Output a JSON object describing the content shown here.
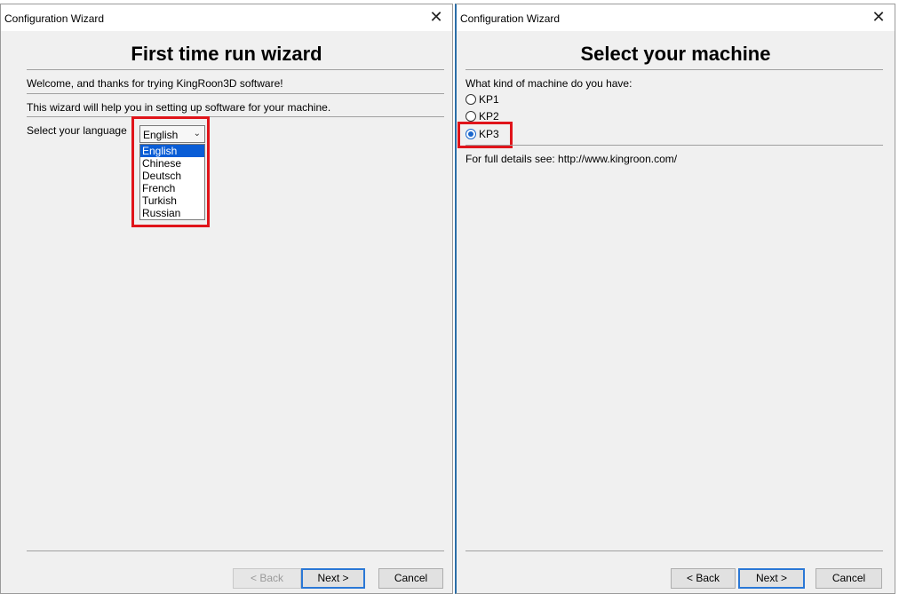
{
  "left": {
    "window_title": "Configuration Wizard",
    "close_glyph": "✕",
    "heading": "First time run wizard",
    "welcome_text": "Welcome, and thanks for trying KingRoon3D software!",
    "help_text": "This wizard will help you in setting up software for your machine.",
    "language_label": "Select your language",
    "language_selected": "English",
    "language_options": [
      "English",
      "Chinese",
      "Deutsch",
      "French",
      "Turkish",
      "Russian"
    ],
    "buttons": {
      "back": "< Back",
      "next": "Next >",
      "cancel": "Cancel"
    }
  },
  "right": {
    "window_title": "Configuration Wizard",
    "close_glyph": "✕",
    "heading": "Select your machine",
    "question": "What kind of machine do you have:",
    "machines": [
      "KP1",
      "KP2",
      "KP3"
    ],
    "selected_machine": "KP3",
    "details_text": "For full details see: http://www.kingroon.com/",
    "buttons": {
      "back": "< Back",
      "next": "Next >",
      "cancel": "Cancel"
    }
  },
  "colors": {
    "highlight": "#e0141a",
    "selection": "#0a5dd6",
    "window_bg": "#f0f0f0"
  },
  "icons": {
    "dropdown_arrow": "chevron-down-icon",
    "close": "close-icon"
  }
}
